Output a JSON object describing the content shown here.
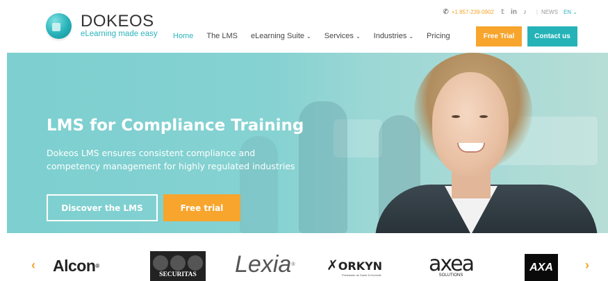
{
  "brand": {
    "name": "DOKEOS",
    "tagline": "eLearning made easy"
  },
  "topbar": {
    "phone": "+1 857-239-0902",
    "news": "NEWS",
    "lang": "EN"
  },
  "nav": {
    "items": [
      {
        "label": "Home",
        "active": true,
        "dropdown": false
      },
      {
        "label": "The LMS",
        "dropdown": false
      },
      {
        "label": "eLearning Suite",
        "dropdown": true
      },
      {
        "label": "Services",
        "dropdown": true
      },
      {
        "label": "Industries",
        "dropdown": true
      },
      {
        "label": "Pricing",
        "dropdown": false
      }
    ],
    "free_trial": "Free Trial",
    "contact": "Contact us"
  },
  "hero": {
    "title": "LMS for Compliance Training",
    "subtitle": "Dokeos LMS ensures consistent compliance and competency management for highly regulated industries",
    "discover_btn": "Discover the LMS",
    "free_trial_btn": "Free trial"
  },
  "clients": {
    "prev": "‹",
    "next": "›",
    "alcon": "Alcon",
    "securitas": "SECURITAS",
    "lexia": "Lexia",
    "orkyn": "ORKYN",
    "orkyn_tag": "Prestataire de Santé À Domicile",
    "axea": "axea",
    "axea_tag": "SOLUTIONS",
    "axa": "AXA"
  },
  "colors": {
    "teal": "#25b3b8",
    "orange": "#f7a52d"
  }
}
